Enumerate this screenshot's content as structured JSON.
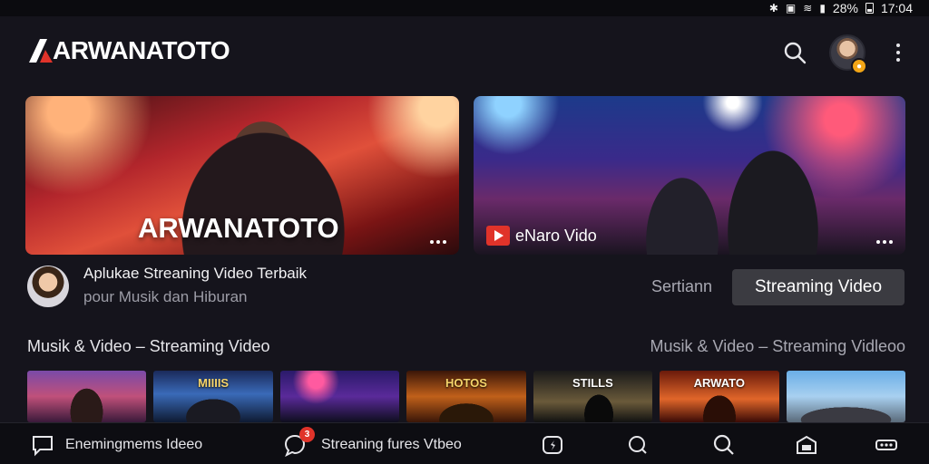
{
  "status_bar": {
    "battery": "28%",
    "time": "17:04"
  },
  "header": {
    "brand": "ARWANATOTO"
  },
  "hero": [
    {
      "title": "ARWANATOTO"
    },
    {
      "chip_label": "eNaro Vido"
    }
  ],
  "channel": {
    "title": "Aplukae Streaning Video Terbaik",
    "subtitle": "pour Musik dan Hiburan",
    "sort_label": "Sertiann",
    "button_label": "Streaming Video"
  },
  "section": {
    "left_title": "Musik & Video – Streaming Video",
    "right_title": "Musik & Video – Streaming Vidleoo"
  },
  "thumbnails": [
    {
      "label": ""
    },
    {
      "label": "MIIIIS"
    },
    {
      "label": ""
    },
    {
      "label": "HOTOS"
    },
    {
      "label": "STILLS"
    },
    {
      "label": "ARWATO"
    },
    {
      "label": ""
    }
  ],
  "bottom_nav": [
    {
      "label": "Enemingmems  Ideeo",
      "icon": "chat-bubble-icon"
    },
    {
      "label": "Streaning fures  Vtbeo",
      "icon": "comment-icon",
      "badge": "3"
    },
    {
      "label": "",
      "icon": "compass-icon"
    },
    {
      "label": "",
      "icon": "search-bubble-icon"
    },
    {
      "label": "",
      "icon": "search-icon"
    },
    {
      "label": "",
      "icon": "library-icon"
    },
    {
      "label": "",
      "icon": "more-icon"
    }
  ],
  "colors": {
    "background": "#15141c",
    "accent": "#e0332a",
    "button": "#3b3b41"
  }
}
